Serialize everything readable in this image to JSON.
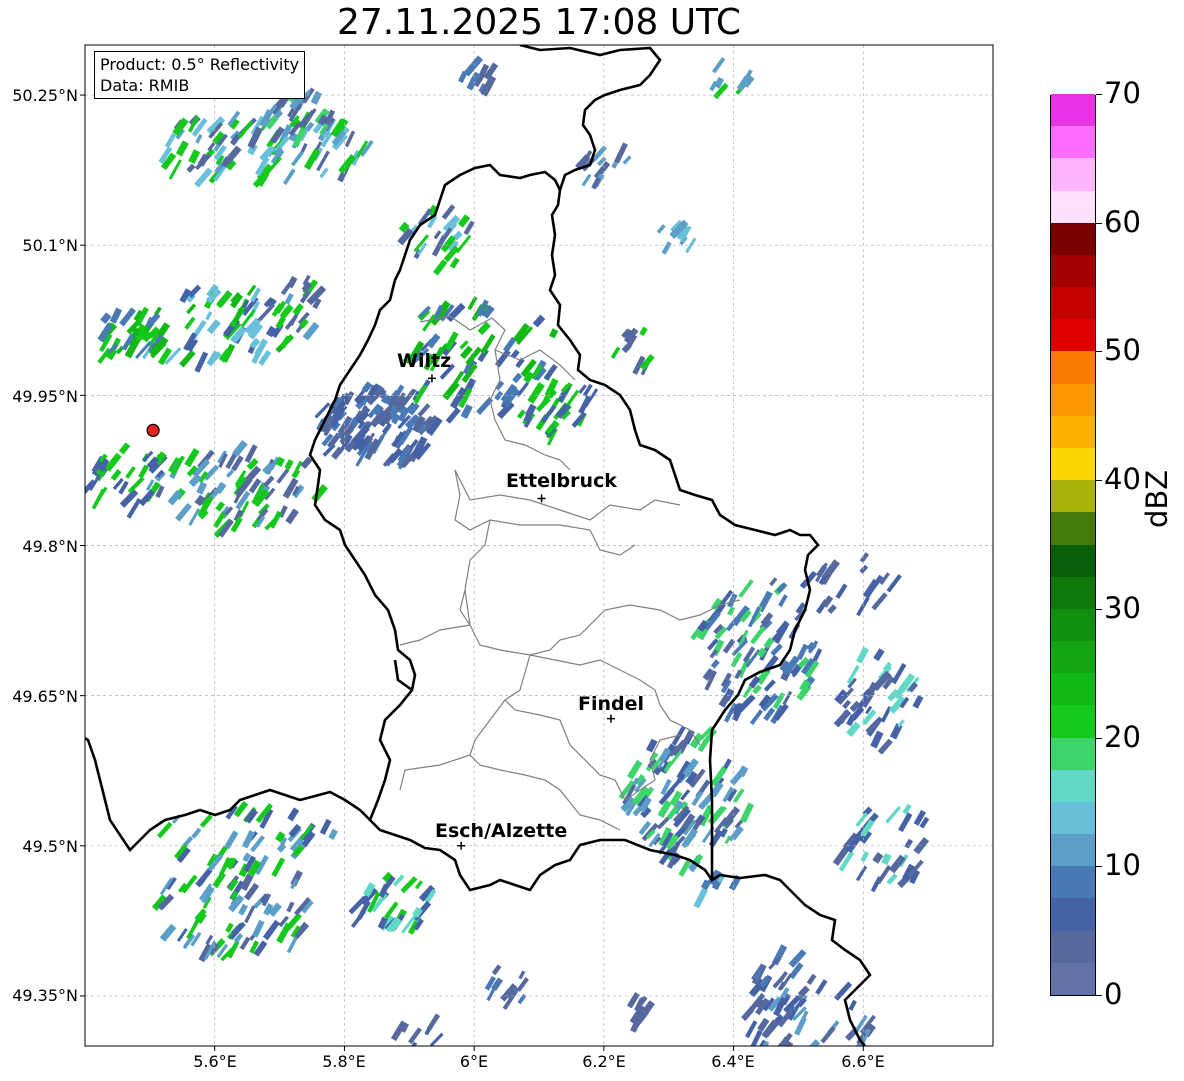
{
  "title": "27.11.2025 17:08 UTC",
  "info": {
    "product": "Product: 0.5° Reflectivity",
    "data": "Data: RMIB"
  },
  "axes": {
    "lat_ticks": [
      "50.25°N",
      "50.1°N",
      "49.95°N",
      "49.8°N",
      "49.65°N",
      "49.5°N",
      "49.35°N"
    ],
    "lon_ticks": [
      "5.6°E",
      "5.8°E",
      "6°E",
      "6.2°E",
      "6.4°E",
      "6.6°E"
    ]
  },
  "cities": [
    {
      "name": "Wiltz",
      "lon": 5.935,
      "lat": 49.967
    },
    {
      "name": "Ettelbruck",
      "lon": 6.104,
      "lat": 49.847
    },
    {
      "name": "Findel",
      "lon": 6.211,
      "lat": 49.627
    },
    {
      "name": "Esch/Alzette",
      "lon": 5.98,
      "lat": 49.5
    }
  ],
  "radar_site": {
    "lon": 5.505,
    "lat": 49.915,
    "color": "#e8211c"
  },
  "colorbar": {
    "label": "dBZ",
    "min": 0,
    "max": 70,
    "ticks": [
      "0",
      "10",
      "20",
      "30",
      "40",
      "50",
      "60",
      "70"
    ],
    "colors": [
      "#6272a8",
      "#56699f",
      "#4662a6",
      "#4a7ab5",
      "#5b9fc8",
      "#68c0da",
      "#62d8c6",
      "#3ed46c",
      "#14c91c",
      "#12b816",
      "#13a512",
      "#118f0f",
      "#0e780d",
      "#095e0a",
      "#467a0b",
      "#a9b107",
      "#fcd600",
      "#fbb300",
      "#fc9900",
      "#fc7c00",
      "#e00000",
      "#c40000",
      "#a30000",
      "#7a0000",
      "#ffe0ff",
      "#ffb4ff",
      "#ff6cff",
      "#e832e8"
    ]
  },
  "colors": {
    "border": "#000000",
    "cantons": "#808080",
    "grid": "#b0b0b0"
  }
}
